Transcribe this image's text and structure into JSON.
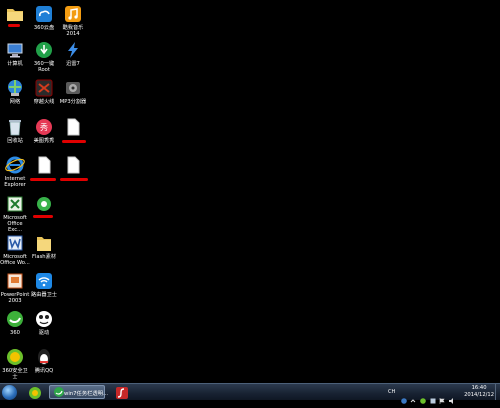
{
  "desktop": {
    "icons": [
      {
        "label": ""
      },
      {
        "label": "360云盘"
      },
      {
        "label": "酷我音乐\n2014"
      },
      {
        "label": "计算机"
      },
      {
        "label": "360一键\nRoot"
      },
      {
        "label": "迅雷7"
      },
      {
        "label": "网络"
      },
      {
        "label": "穿越火线"
      },
      {
        "label": "MP3分割器"
      },
      {
        "label": "回收站"
      },
      {
        "label": "美图秀秀"
      },
      {
        "label": "Internet\nExplorer"
      },
      {
        "label": "Microsoft\nOffice Exc..."
      },
      {
        "label": "Microsoft\nOffice Wo..."
      },
      {
        "label": "Flash素材"
      },
      {
        "label": "PowerPoint\n2003"
      },
      {
        "label": "路由器卫士"
      },
      {
        "label": "360"
      },
      {
        "label": "驱动"
      },
      {
        "label": "360安全卫士"
      },
      {
        "label": "腾讯QQ"
      }
    ]
  },
  "taskbar": {
    "active_window_label": "win7任务栏透明...",
    "tray": {
      "language": "CH",
      "time": "16:40",
      "date": "2014/12/12"
    }
  },
  "colors": {
    "desktop_bg": "#000000",
    "taskbar_bg": "#182232",
    "redaction": "#e00000"
  }
}
